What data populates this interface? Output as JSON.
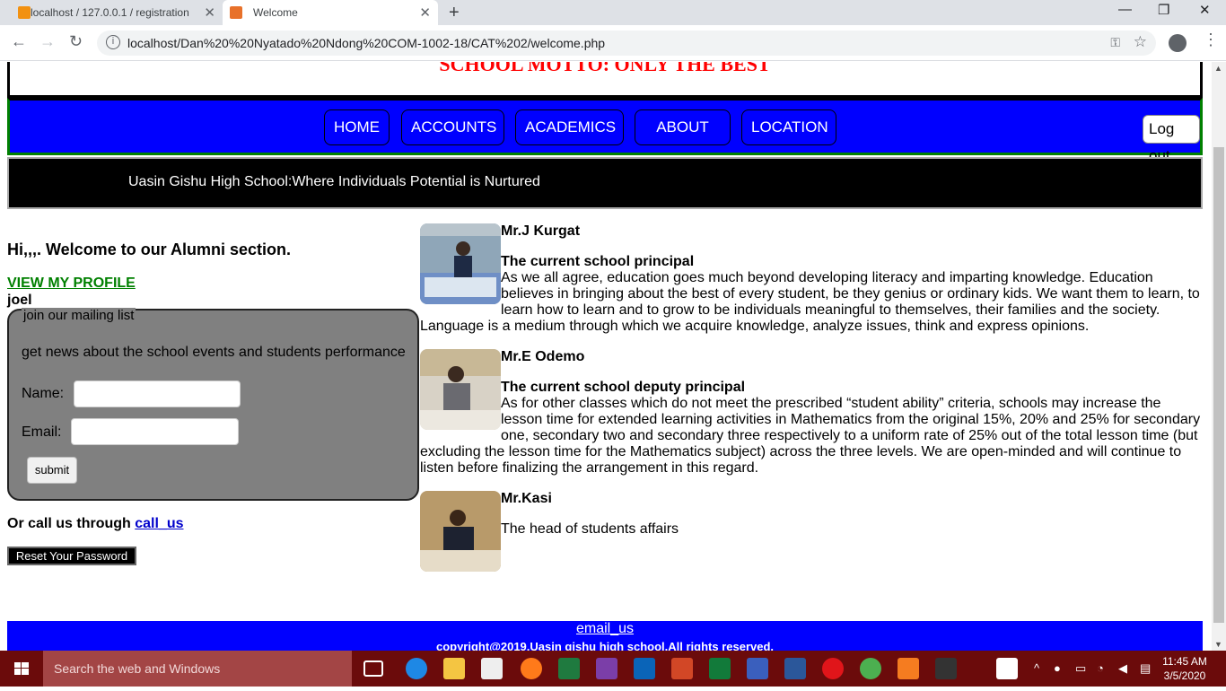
{
  "browser": {
    "tabs": [
      {
        "title": "localhost / 127.0.0.1 / registration"
      },
      {
        "title": "Welcome"
      }
    ],
    "url": "localhost/Dan%20%20Nyatado%20Ndong%20COM-1002-18/CAT%202/welcome.php"
  },
  "header": {
    "motto": "SCHOOL MOTTO: ONLY THE BEST"
  },
  "nav": {
    "items": [
      "HOME",
      "ACCOUNTS",
      "ACADEMICS",
      "ABOUT US",
      "LOCATION"
    ],
    "logout": "Log out"
  },
  "marquee": "Uasin Gishu High School:Where Individuals Potential is Nurtured",
  "sidebar": {
    "welcome": "Hi,,,. Welcome to our Alumni section.",
    "profile_link": "VIEW MY PROFILE",
    "username": "joel",
    "mailing": {
      "legend": "join our mailing list",
      "description": "get news about the school events and students performance",
      "name_label": "Name:",
      "email_label": "Email:",
      "submit": "submit"
    },
    "call_text": "Or call us through ",
    "call_link": "call_us",
    "reset": "Reset Your Password"
  },
  "staff": [
    {
      "name": "Mr.J Kurgat",
      "role": "The current school principal",
      "text": "As we all agree, education goes much beyond developing literacy and imparting knowledge. Education believes in bringing about the best of every student, be they genius or ordinary kids. We want them to learn, to learn how to learn and to grow to be individuals meaningful to themselves, their families and the society. Language is a medium through which we acquire knowledge, analyze issues, think and express opinions."
    },
    {
      "name": "Mr.E Odemo",
      "role": "The current school deputy principal",
      "text": "As for other classes which do not meet the prescribed “student ability” criteria, schools may increase the lesson time for extended learning activities in Mathematics from the original 15%, 20% and 25% for secondary one, secondary two and secondary three respectively to a uniform rate of 25% out of the total lesson time (but excluding the lesson time for the Mathematics subject) across the three levels. We are open-minded and will continue to listen before finalizing the arrangement in this regard."
    },
    {
      "name": "Mr.Kasi",
      "role": "",
      "text": "The head of students affairs"
    }
  ],
  "footer": {
    "email_link": "email_us",
    "copyright": "copyright@2019,Uasin gishu high school.All rights reserved."
  },
  "taskbar": {
    "search_placeholder": "Search the web and Windows",
    "time": "11:45 AM",
    "date": "3/5/2020"
  }
}
